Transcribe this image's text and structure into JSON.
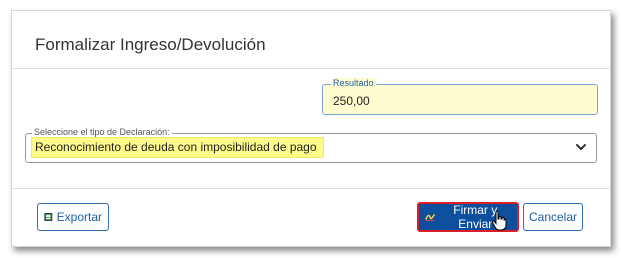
{
  "dialog": {
    "title": "Formalizar Ingreso/Devolución"
  },
  "resultado": {
    "legend": "Resultado",
    "value": "250,00"
  },
  "tipo_declaracion": {
    "legend": "Seleccione el tipo de Declaración:",
    "selected": "Reconocimiento de deuda con imposibilidad de pago"
  },
  "buttons": {
    "exportar": "Exportar",
    "firmar": "Firmar y Enviar",
    "cancelar": "Cancelar"
  },
  "icons": {
    "exportar": "export-icon",
    "firmar": "signature-icon",
    "select": "chevron-down-icon",
    "pointer": "cursor-icon"
  },
  "colors": {
    "primary": "#0d4f9c",
    "highlight": "#fffb8a",
    "field_bg": "#fffdd0",
    "focus_border": "#d9202a"
  }
}
